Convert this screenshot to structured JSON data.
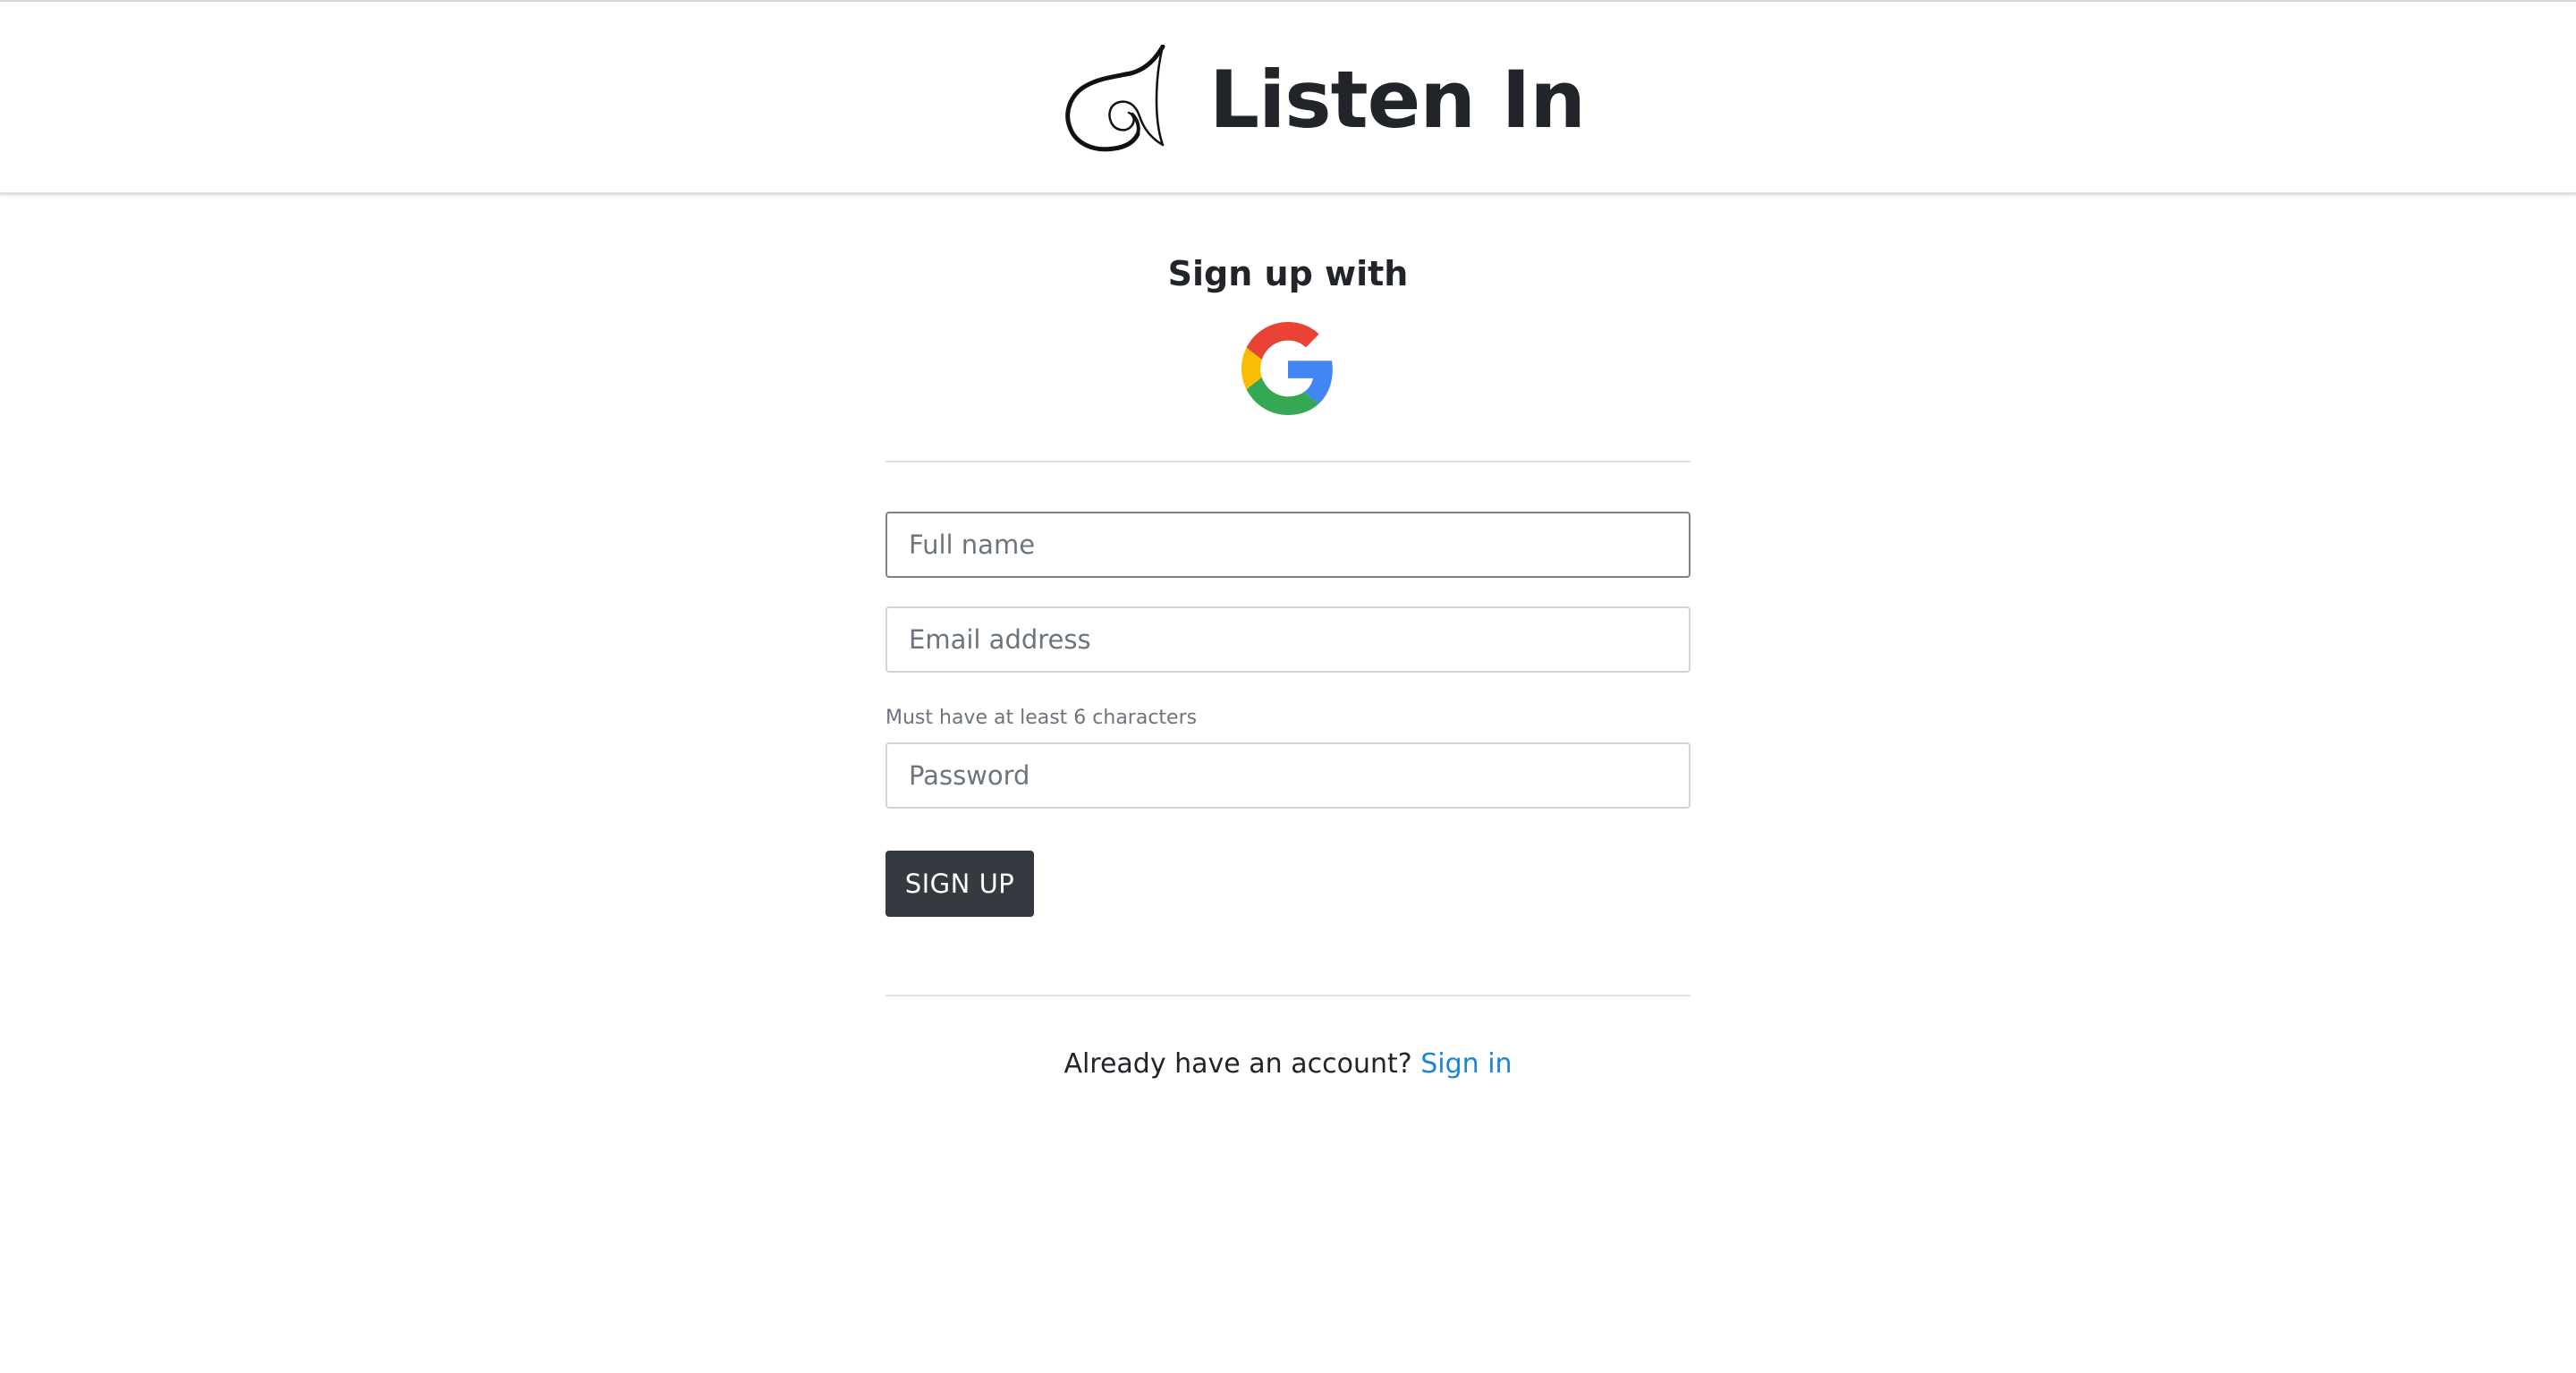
{
  "brand": {
    "name": "Listen In",
    "logo_icon": "gramophone-horn-icon"
  },
  "signup": {
    "heading": "Sign up with",
    "google_icon": "google-g-icon",
    "full_name_placeholder": "Full name",
    "email_placeholder": "Email address",
    "password_hint": "Must have at least 6 characters",
    "password_placeholder": "Password",
    "submit_label": "SIGN UP"
  },
  "footer": {
    "prompt": "Already have an account?",
    "signin_link": "Sign in"
  },
  "colors": {
    "primary_button": "#343a40",
    "link": "#1a86d6",
    "google_red": "#EA4335",
    "google_yellow": "#FBBC05",
    "google_green": "#34A853",
    "google_blue": "#4285F4"
  }
}
